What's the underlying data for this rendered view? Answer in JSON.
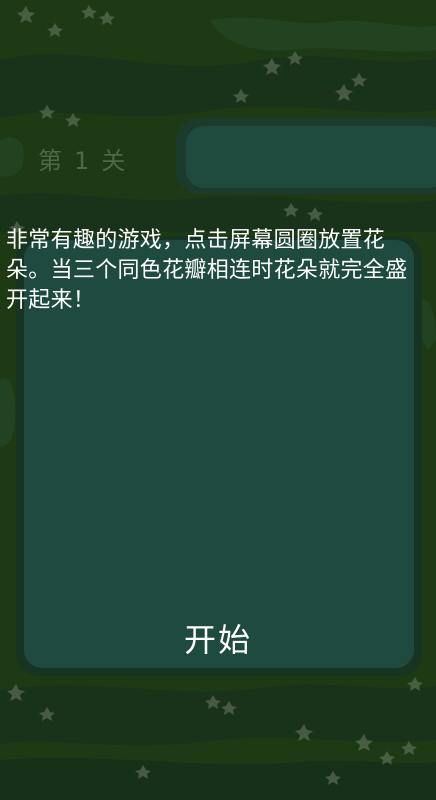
{
  "level": {
    "prefix": "第",
    "number": "1",
    "suffix": "关"
  },
  "panel": {
    "description": "非常有趣的游戏，点击屏幕圆圈放置花朵。当三个同色花瓣相连时花朵就完全盛开起来！",
    "start_label": "开始"
  },
  "colors": {
    "background": "#1d3a14",
    "panel": "#1e4a3f",
    "level_bar": "#1f4a3e",
    "level_text": "#4b6a4a",
    "text": "#ffffff"
  }
}
